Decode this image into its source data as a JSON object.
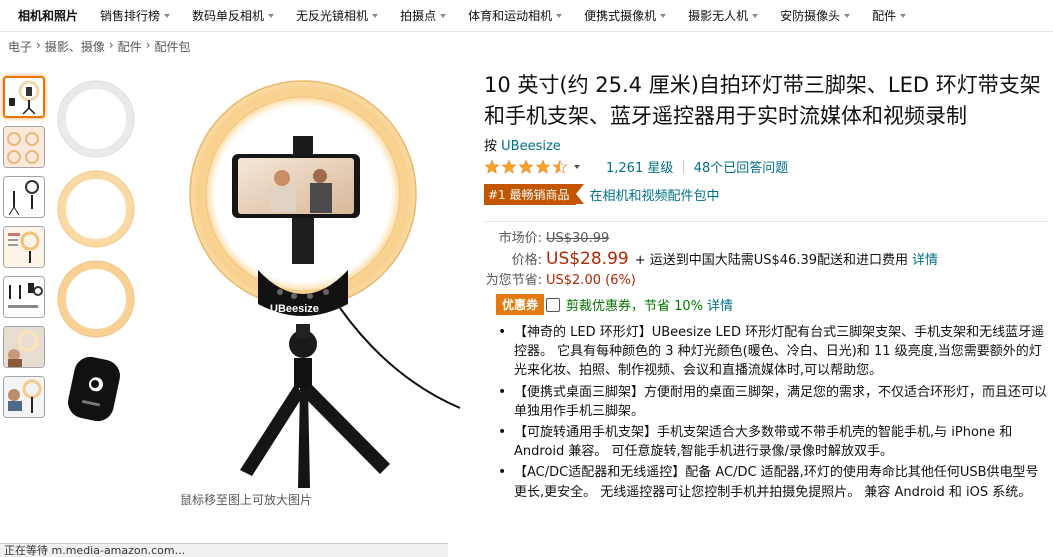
{
  "subnav": {
    "items": [
      {
        "label": "相机和照片",
        "caret": false
      },
      {
        "label": "销售排行榜",
        "caret": true
      },
      {
        "label": "数码单反相机",
        "caret": true
      },
      {
        "label": "无反光镜相机",
        "caret": true
      },
      {
        "label": "拍摄点",
        "caret": true
      },
      {
        "label": "体育和运动相机",
        "caret": true
      },
      {
        "label": "便携式摄像机",
        "caret": true
      },
      {
        "label": "摄影无人机",
        "caret": true
      },
      {
        "label": "安防摄像头",
        "caret": true
      },
      {
        "label": "配件",
        "caret": true
      }
    ]
  },
  "breadcrumb": {
    "items": [
      "电子",
      "摄影、摄像",
      "配件",
      "配件包"
    ],
    "separator": "›"
  },
  "gallery": {
    "hover_hint": "鼠标移至图上可放大图片",
    "thumb_count": 7
  },
  "status_bar": "正在等待 m.media-amazon.com...",
  "product": {
    "title": "10 英寸(约 25.4 厘米)自拍环灯带三脚架、LED 环灯带支架和手机支架、蓝牙遥控器用于实时流媒体和视频录制",
    "brand_prefix": "按",
    "brand": "UBeesize",
    "rating": 4.5,
    "ratings_text": "1,261 星级",
    "qa_text": "48个已回答问题",
    "bestseller_badge": "#1 最畅销商品",
    "bestseller_category": "在相机和视频配件包中",
    "list_price_label": "市场价:",
    "list_price": "US$30.99",
    "price_label": "价格:",
    "price": "US$28.99",
    "shipping": "+ 运送到中国大陆需US$46.39配送和进口费用",
    "details_link": "详情",
    "savings_label": "为您节省:",
    "savings": "US$2.00 (6%)",
    "coupon_badge": "优惠券",
    "coupon_text": "剪裁优惠券，节省 10%",
    "coupon_details": "详情",
    "bullets": [
      "【神奇的 LED 环形灯】UBeesize LED 环形灯配有台式三脚架支架、手机支架和无线蓝牙遥控器。 它具有每种颜色的 3 种灯光颜色(暖色、冷白、日光)和 11 级亮度,当您需要额外的灯光来化妆、拍照、制作视频、会议和直播流媒体时,可以帮助您。",
      "【便携式桌面三脚架】方便耐用的桌面三脚架，满足您的需求，不仅适合环形灯，而且还可以单独用作手机三脚架。",
      "【可旋转通用手机支架】手机支架适合大多数带或不带手机壳的智能手机,与 iPhone 和 Android 兼容。 可任意旋转,智能手机进行录像/录像时解放双手。",
      "【AC/DC适配器和无线遥控】配备 AC/DC 适配器,环灯的使用寿命比其他任何USB供电型号更长,更安全。 无线遥控器可让您控制手机并拍摄免提照片。 兼容 Android 和 iOS 系统。"
    ]
  },
  "colors": {
    "link": "#007185",
    "price": "#b12704",
    "badge": "#c45500",
    "coupon": "#e47911",
    "star": "#ffa41c"
  }
}
